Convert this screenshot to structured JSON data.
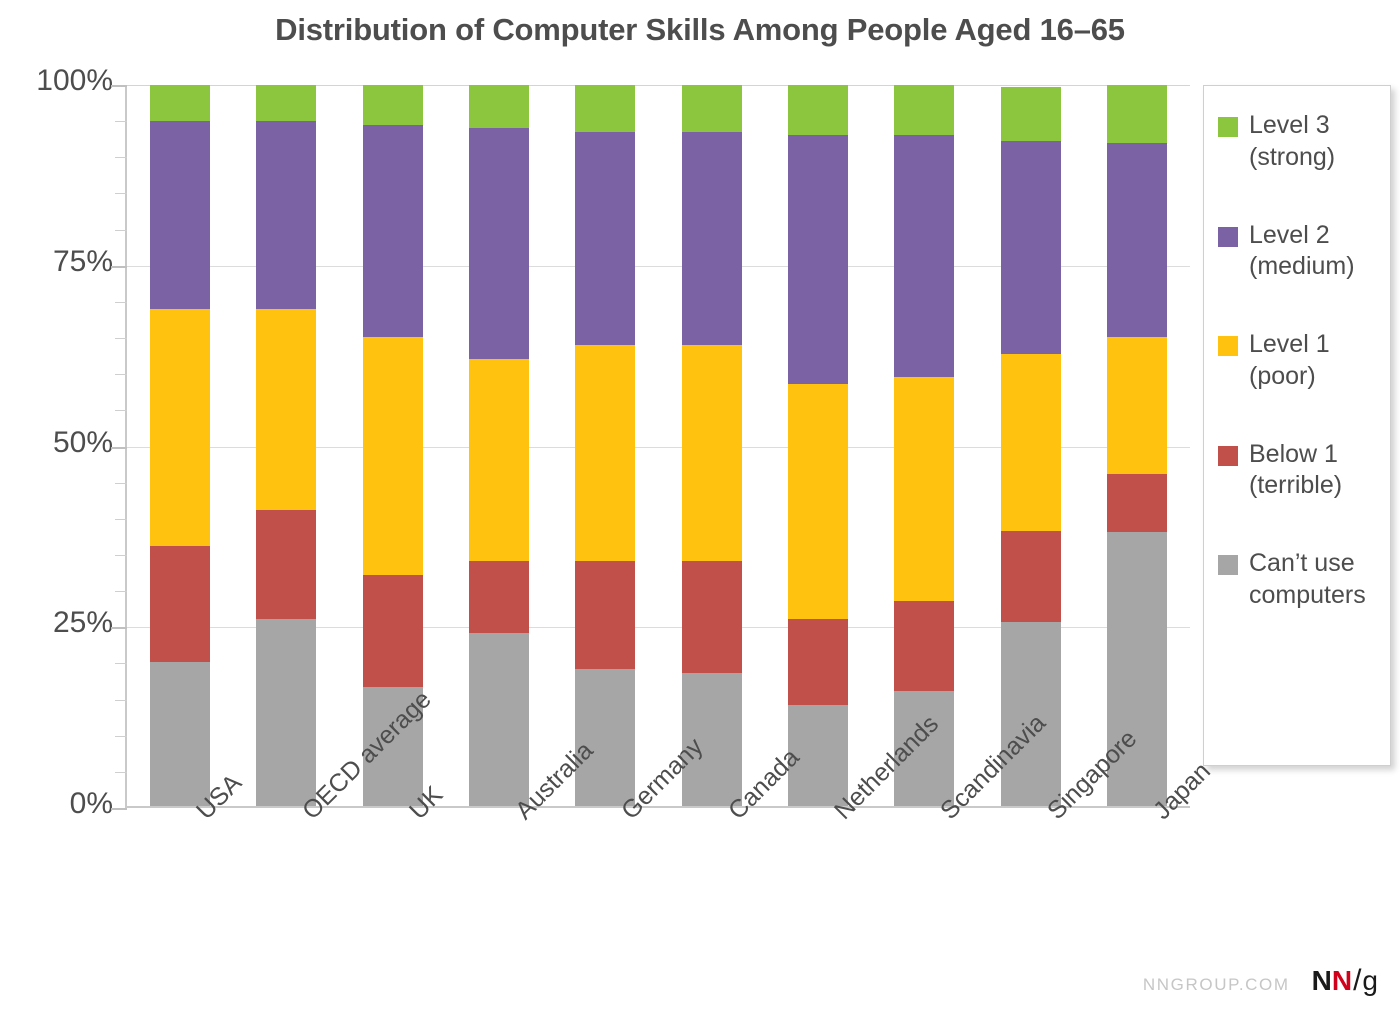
{
  "chart_data": {
    "type": "bar",
    "subtype": "stacked-100-percent",
    "title": "Distribution of Computer Skills Among People Aged 16–65",
    "xlabel": "",
    "ylabel": "",
    "ylim": [
      0,
      100
    ],
    "ytick_labels": [
      "100%",
      "75%",
      "50%",
      "25%",
      "0%"
    ],
    "ytick_values": [
      100,
      75,
      50,
      25,
      0
    ],
    "minor_tick_interval": 5,
    "grid": true,
    "legend_position": "right",
    "categories": [
      "USA",
      "OECD average",
      "UK",
      "Australia",
      "Germany",
      "Canada",
      "Netherlands",
      "Scandinavia",
      "Singapore",
      "Japan"
    ],
    "series": [
      {
        "name": "Can’t use computers",
        "legend_label": "Can’t use\ncomputers",
        "color": "#a6a6a6",
        "values": [
          20,
          26,
          16.5,
          24,
          19,
          18.5,
          14,
          16,
          25.5,
          38
        ]
      },
      {
        "name": "Below 1 (terrible)",
        "legend_label": "Below 1\n(terrible)",
        "color": "#c1504b",
        "values": [
          16,
          15,
          15.5,
          10,
          15,
          15.5,
          12,
          12.5,
          12.5,
          8
        ]
      },
      {
        "name": "Level 1 (poor)",
        "legend_label": "Level 1\n(poor)",
        "color": "#ffc20e",
        "values": [
          33,
          28,
          33,
          28,
          30,
          30,
          32.5,
          31,
          24.5,
          19
        ]
      },
      {
        "name": "Level 2 (medium)",
        "legend_label": "Level 2\n(medium)",
        "color": "#7b62a5",
        "values": [
          26,
          26,
          29.5,
          32,
          29.5,
          29.5,
          34.5,
          33.5,
          29.5,
          27
        ]
      },
      {
        "name": "Level 3 (strong)",
        "legend_label": "Level 3\n(strong)",
        "color": "#8cc63e",
        "values": [
          5,
          5,
          5.5,
          6,
          6.5,
          6.5,
          7,
          7,
          7.5,
          8
        ]
      }
    ],
    "cumulative_tops": {
      "USA": [
        20,
        36,
        69,
        95,
        100
      ],
      "OECD average": [
        26,
        41,
        69,
        95,
        100
      ],
      "UK": [
        16.5,
        32,
        65,
        94.5,
        100
      ],
      "Australia": [
        24,
        34,
        62,
        94,
        100
      ],
      "Germany": [
        19,
        34,
        64,
        93.5,
        100
      ],
      "Canada": [
        18.5,
        34,
        64,
        93.5,
        100
      ],
      "Netherlands": [
        14,
        26,
        58.5,
        93,
        100
      ],
      "Scandinavia": [
        16,
        28.5,
        59.5,
        93,
        100
      ],
      "Singapore": [
        25.5,
        38,
        63,
        92.5,
        100
      ],
      "Japan": [
        38,
        46,
        65,
        92,
        100
      ]
    }
  },
  "legend": {
    "items": [
      {
        "label": "Level 3\n(strong)",
        "color": "#8cc63e"
      },
      {
        "label": "Level 2\n(medium)",
        "color": "#7b62a5"
      },
      {
        "label": "Level 1\n(poor)",
        "color": "#ffc20e"
      },
      {
        "label": "Below 1\n(terrible)",
        "color": "#c1504b"
      },
      {
        "label": "Can’t use\ncomputers",
        "color": "#a6a6a6"
      }
    ]
  },
  "footer": {
    "url": "NNGROUP.COM",
    "logo_n1": "N",
    "logo_n2": "N",
    "logo_slash": "/",
    "logo_g": "g"
  },
  "colors": {
    "green": "#8cc63e",
    "purple": "#7b62a5",
    "yellow": "#ffc20e",
    "red": "#c1504b",
    "gray": "#a6a6a6",
    "text": "#4d4d4d",
    "grid": "#dcdcdc",
    "logo_red": "#d0021b"
  }
}
